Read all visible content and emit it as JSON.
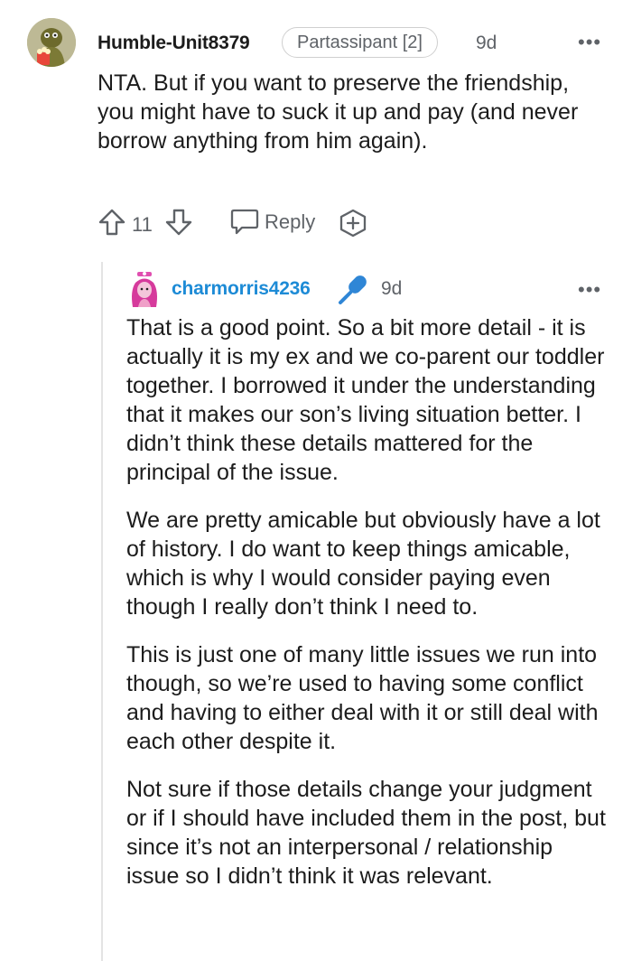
{
  "comment": {
    "author": "Humble-Unit8379",
    "flair": "Partassipant [2]",
    "time": "9d",
    "text": "NTA. But if you want to preserve the friendship, you might have to suck it up and pay (and never borrow anything from him again).",
    "votes": "11",
    "reply_label": "Reply"
  },
  "reply": {
    "author": "charmorris4236",
    "author_color": "#1d8bd6",
    "time": "9d",
    "paragraphs": [
      "That is a good point. So a bit more detail - it is actually it is my ex and we co-parent our toddler together. I borrowed it under the understanding that it makes our son’s living situation better. I didn’t think these details mattered for the principal of the issue.",
      "We are pretty amicable but obviously have a lot of history. I do want to keep things amicable, which is why I would consider paying even though I really don’t think I need to.",
      "This is just one of many little issues we run into though, so we’re used to having some conflict and having to either deal with it or still deal with each other despite it.",
      "Not sure if those details change your judgment or if I should have included them in the post, but since it’s not an interpersonal / relationship issue so I didn’t think it was relevant."
    ]
  },
  "icons": {
    "more": "more-options-icon",
    "upvote": "upvote-icon",
    "downvote": "downvote-icon",
    "reply": "reply-icon",
    "award": "award-icon",
    "microphone": "microphone-icon"
  }
}
